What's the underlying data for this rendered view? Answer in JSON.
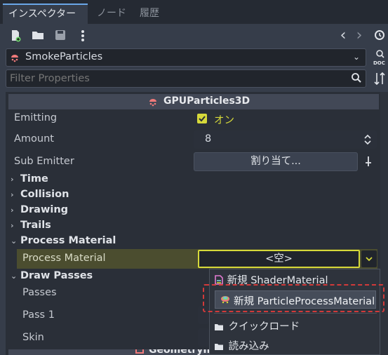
{
  "tabs": [
    {
      "label": "インスペクター",
      "active": true
    },
    {
      "label": "ノード",
      "active": false
    },
    {
      "label": "履歴",
      "active": false
    }
  ],
  "toolbar": {
    "nav_back": "‹",
    "nav_forward": "›"
  },
  "object_selector": {
    "value": "SmokeParticles"
  },
  "filter": {
    "placeholder": "Filter Properties"
  },
  "inspector": {
    "class_header": "GPUParticles3D",
    "emitting": {
      "label": "Emitting",
      "value": "オン",
      "checked": true
    },
    "amount": {
      "label": "Amount",
      "value": "8"
    },
    "sub_emitter": {
      "label": "Sub Emitter",
      "button": "割り当て..."
    },
    "sections": {
      "time": "Time",
      "collision": "Collision",
      "drawing": "Drawing",
      "trails": "Trails",
      "process_material": "Process Material",
      "draw_passes": "Draw Passes"
    },
    "process_material": {
      "label": "Process Material",
      "value": "<空>"
    },
    "passes": {
      "label": "Passes"
    },
    "pass1": {
      "label": "Pass 1"
    },
    "skin": {
      "label": "Skin"
    },
    "next_header": "GeometryIn"
  },
  "dropdown": {
    "items": [
      "新規 ShaderMaterial",
      "新規 ParticleProcessMaterial",
      "クイックロード",
      "読み込み"
    ]
  },
  "colors": {
    "accent": "#6aa6e8",
    "highlight_row": "#4b4d2f",
    "selection_outline": "#d23a3a",
    "checkbox": "#d6d93a"
  }
}
